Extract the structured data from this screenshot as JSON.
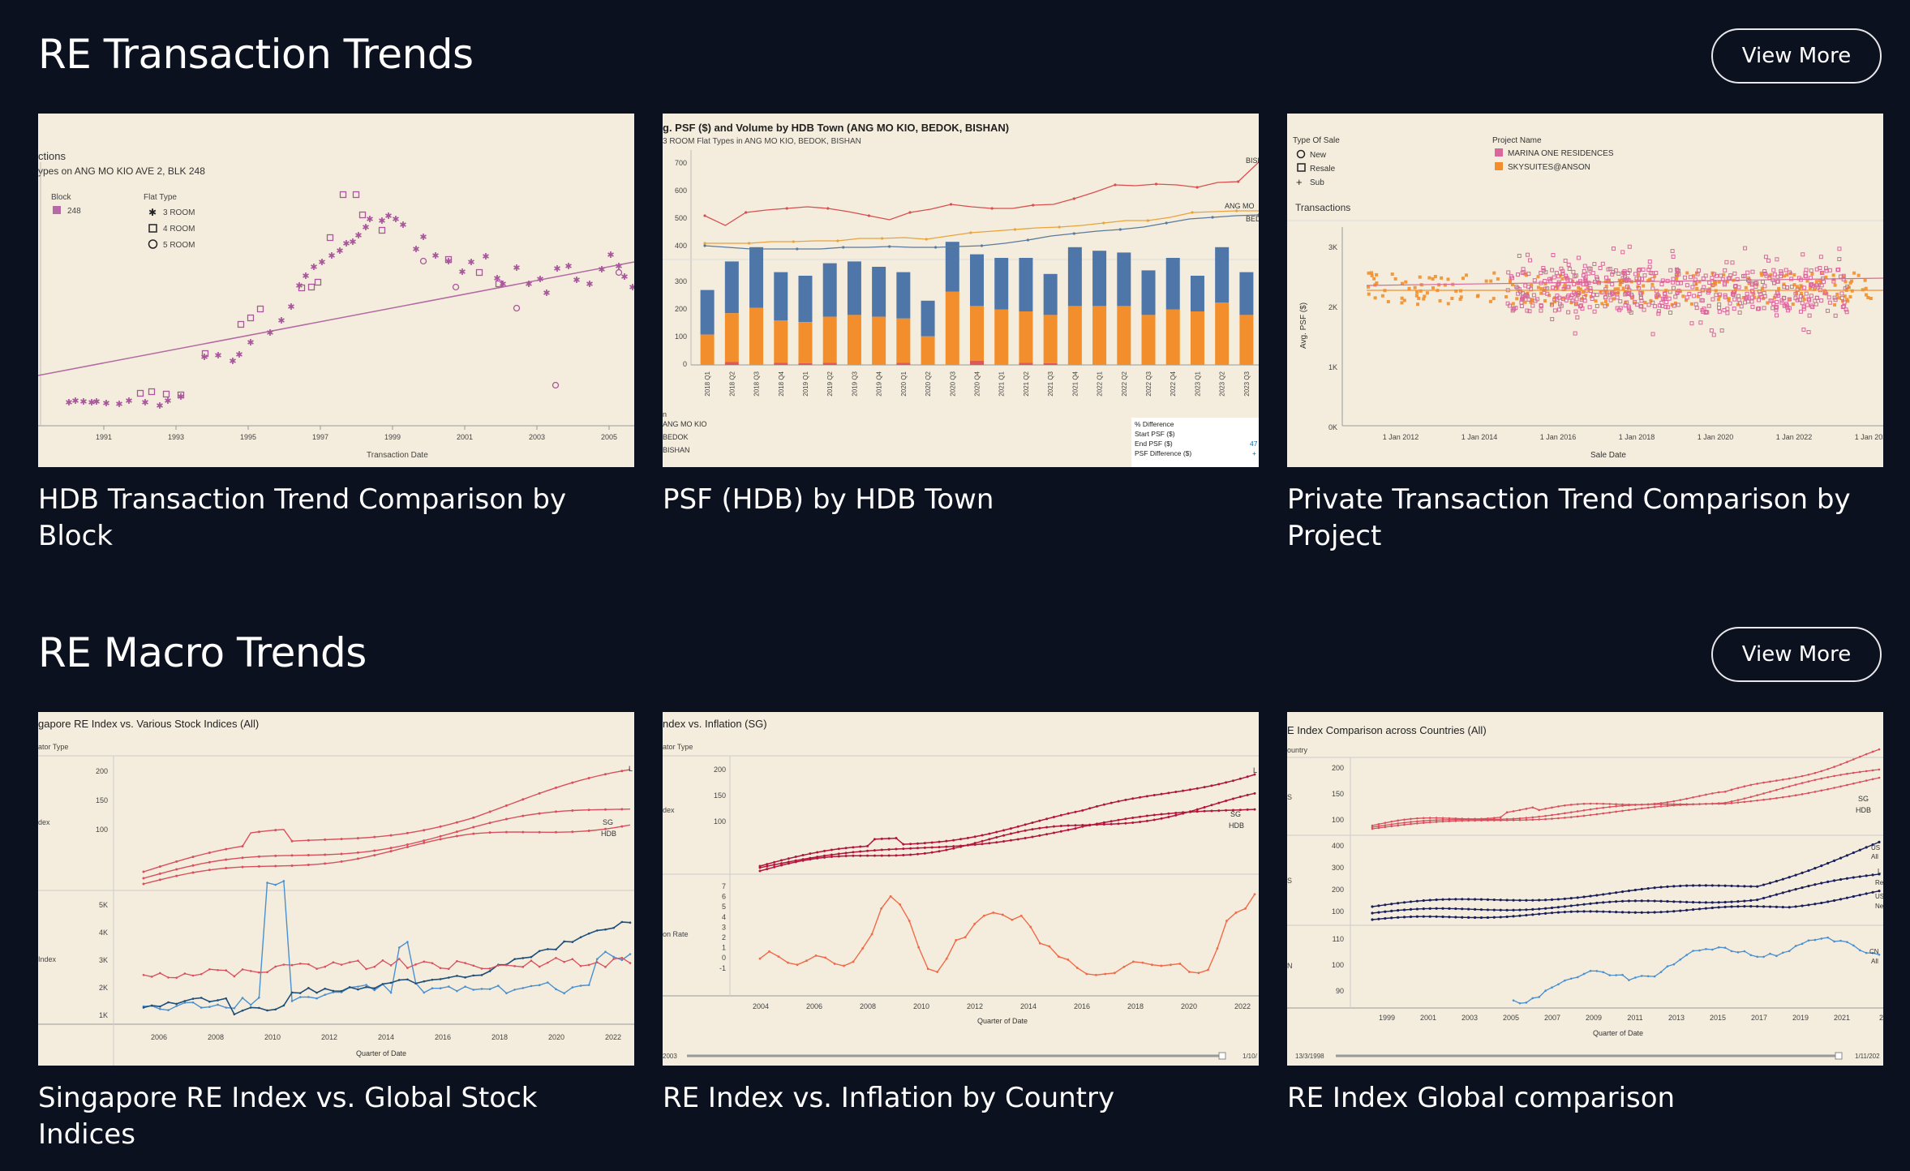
{
  "sections": [
    {
      "title": "RE Transaction Trends",
      "view_more": "View More",
      "cards": [
        {
          "title": "HDB Transaction Trend Comparison by Block",
          "thumb": {
            "title": "ctions",
            "subtitle": "ypes on ANG MO KIO AVE 2, BLK 248",
            "legend_block_title": "Block",
            "legend_block_item": "248",
            "legend_flat_title": "Flat Type",
            "legend_flat_items": [
              "3 ROOM",
              "4 ROOM",
              "5 ROOM"
            ],
            "x_ticks": [
              "1991",
              "1993",
              "1995",
              "1997",
              "1999",
              "2001",
              "2003",
              "2005"
            ],
            "xlabel": "Transaction Date",
            "colors": {
              "marks": "#a8579a",
              "trend": "#b06aa0"
            }
          }
        },
        {
          "title": "PSF (HDB) by HDB Town",
          "thumb": {
            "title": "g. PSF ($) and Volume by HDB Town (ANG MO KIO, BEDOK, BISHAN)",
            "subtitle": "3 ROOM Flat Types in ANG MO KIO, BEDOK, BISHAN",
            "psf_ticks": [
              "700",
              "600",
              "500",
              "400"
            ],
            "vol_ticks": [
              "300",
              "200",
              "100",
              "0"
            ],
            "quarters": [
              "2018 Q1",
              "2018 Q2",
              "2018 Q3",
              "2018 Q4",
              "2019 Q1",
              "2019 Q2",
              "2019 Q3",
              "2019 Q4",
              "2020 Q1",
              "2020 Q2",
              "2020 Q3",
              "2020 Q4",
              "2021 Q1",
              "2021 Q2",
              "2021 Q3",
              "2021 Q4",
              "2022 Q1",
              "2022 Q2",
              "2022 Q3",
              "2022 Q4",
              "2023 Q1",
              "2023 Q2",
              "2023 Q3"
            ],
            "line_labels": [
              "BISH",
              "ANG MO",
              "BED"
            ],
            "towns": [
              "ANG MO KIO",
              "BEDOK",
              "BISHAN"
            ],
            "town_header": "n",
            "diff_table": [
              "% Difference",
              "Start PSF ($)",
              "End PSF ($)",
              "PSF Difference ($)"
            ],
            "diff_values": [
              "47",
              "+"
            ],
            "colors": {
              "blue": "#4f76a8",
              "orange": "#f28e2b",
              "red": "#e15759",
              "line1": "#d94f4f",
              "line2": "#e8a33b",
              "line3": "#5b7a99"
            }
          }
        },
        {
          "title": "Private Transaction Trend Comparison by Project",
          "thumb": {
            "legend_sale_title": "Type Of Sale",
            "legend_sale_items": [
              "New",
              "Resale",
              "Sub"
            ],
            "legend_project_title": "Project Name",
            "legend_project_items": [
              "MARINA ONE RESIDENCES",
              "SKYSUITES@ANSON"
            ],
            "section_label": "Transactions",
            "ylabel": "Avg. PSF ($)",
            "y_ticks": [
              "3K",
              "2K",
              "1K",
              "0K"
            ],
            "x_ticks": [
              "1 Jan 2012",
              "1 Jan 2014",
              "1 Jan 2016",
              "1 Jan 2018",
              "1 Jan 2020",
              "1 Jan 2022",
              "1 Jan 2024"
            ],
            "xlabel": "Sale Date",
            "colors": {
              "pink": "#d9679b",
              "orange": "#f28e2b"
            }
          }
        }
      ]
    },
    {
      "title": "RE Macro Trends",
      "view_more": "View More",
      "cards": [
        {
          "title": "Singapore RE Index vs. Global Stock Indices",
          "thumb": {
            "title": "gapore RE Index vs. Various Stock Indices (All)",
            "legend_hint": "ator Type",
            "top_axis_label": "dex",
            "bottom_axis_label": "Index",
            "top_ticks": [
              "200",
              "150",
              "100"
            ],
            "bottom_ticks": [
              "5K",
              "4K",
              "3K",
              "2K",
              "1K"
            ],
            "line_labels": [
              "L",
              "SG",
              "HDB"
            ],
            "x_ticks": [
              "2006",
              "2008",
              "2010",
              "2012",
              "2014",
              "2016",
              "2018",
              "2020",
              "2022"
            ],
            "xlabel": "Quarter of Date",
            "colors": {
              "red": "#d94f5c",
              "blue": "#4a90d0",
              "navy": "#1f4e79"
            }
          }
        },
        {
          "title": "RE Index vs. Inflation by Country",
          "thumb": {
            "title": "ndex vs. Inflation (SG)",
            "legend_hint": "ator Type",
            "top_axis_label": "dex",
            "bottom_axis_label": "on Rate",
            "top_ticks": [
              "200",
              "150",
              "100"
            ],
            "bottom_ticks": [
              "7",
              "6",
              "5",
              "4",
              "3",
              "2",
              "1",
              "0",
              "-1"
            ],
            "line_labels": [
              "L",
              "SG",
              "HDB"
            ],
            "x_ticks": [
              "2004",
              "2006",
              "2008",
              "2010",
              "2012",
              "2014",
              "2016",
              "2018",
              "2020",
              "2022"
            ],
            "xlabel": "Quarter of Date",
            "slider_start": "2003",
            "slider_end": "1/10/",
            "colors": {
              "crimson": "#b3143c",
              "orange": "#ef6b4a"
            }
          }
        },
        {
          "title": "RE Index Global comparison",
          "thumb": {
            "title": "E Index Comparison across Countries (All)",
            "legend_hint": "ountry",
            "axis_labels": [
              "S",
              "S",
              "N"
            ],
            "top_ticks": [
              "200",
              "150",
              "100"
            ],
            "mid_ticks": [
              "400",
              "300",
              "200",
              "100"
            ],
            "bottom_ticks": [
              "110",
              "100",
              "90"
            ],
            "top_labels": [
              "SG",
              "HDB"
            ],
            "mid_labels": [
              "US",
              "All",
              "L",
              "Re",
              "US",
              "Ne"
            ],
            "bottom_labels": [
              "CN",
              "All"
            ],
            "x_ticks": [
              "1999",
              "2001",
              "2003",
              "2005",
              "2007",
              "2009",
              "2011",
              "2013",
              "2015",
              "2017",
              "2019",
              "2021",
              "20"
            ],
            "xlabel": "Quarter of Date",
            "slider_start": "13/3/1998",
            "slider_end": "1/11/202",
            "colors": {
              "red": "#d94f5c",
              "navy": "#1a1f5c",
              "blue": "#4a90d0"
            }
          }
        }
      ]
    }
  ]
}
